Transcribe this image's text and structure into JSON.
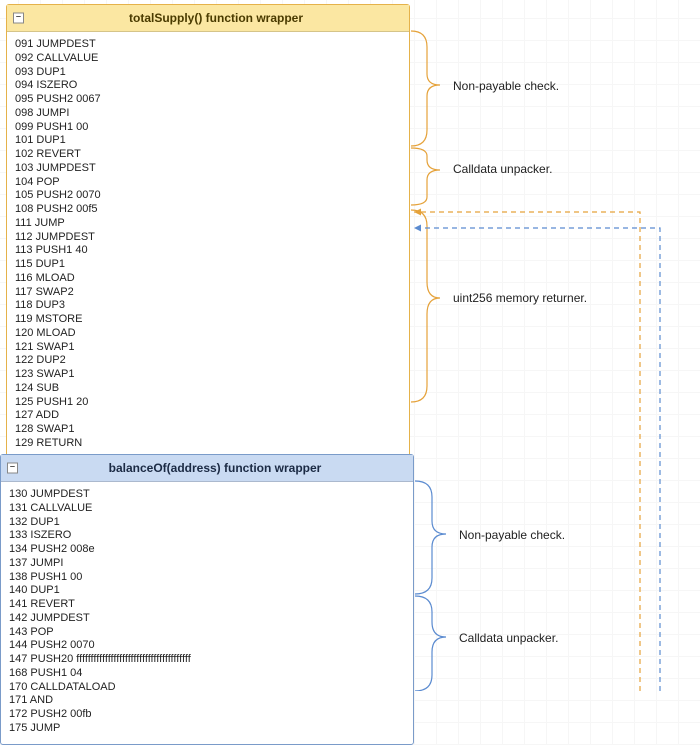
{
  "panels": {
    "totalSupply": {
      "title": "totalSupply() function wrapper",
      "collapse_glyph": "−",
      "instructions": [
        "091 JUMPDEST",
        "092 CALLVALUE",
        "093 DUP1",
        "094 ISZERO",
        "095 PUSH2 0067",
        "098 JUMPI",
        "099 PUSH1 00",
        "101 DUP1",
        "102 REVERT",
        "103 JUMPDEST",
        "104 POP",
        "105 PUSH2 0070",
        "108 PUSH2 00f5",
        "111 JUMP",
        "112 JUMPDEST",
        "113 PUSH1 40",
        "115 DUP1",
        "116 MLOAD",
        "117 SWAP2",
        "118 DUP3",
        "119 MSTORE",
        "120 MLOAD",
        "121 SWAP1",
        "122 DUP2",
        "123 SWAP1",
        "124 SUB",
        "125 PUSH1 20",
        "127 ADD",
        "128 SWAP1",
        "129 RETURN"
      ]
    },
    "balanceOf": {
      "title": "balanceOf(address) function wrapper",
      "collapse_glyph": "−",
      "instructions": [
        "130 JUMPDEST",
        "131 CALLVALUE",
        "132 DUP1",
        "133 ISZERO",
        "134 PUSH2 008e",
        "137 JUMPI",
        "138 PUSH1 00",
        "140 DUP1",
        "141 REVERT",
        "142 JUMPDEST",
        "143 POP",
        "144 PUSH2 0070",
        "147 PUSH20 ffffffffffffffffffffffffffffffffffffffff",
        "168 PUSH1 04",
        "170 CALLDATALOAD",
        "171 AND",
        "172 PUSH2 00fb",
        "175 JUMP"
      ]
    }
  },
  "labels": {
    "l1": "Non-payable check.",
    "l2": "Calldata unpacker.",
    "l3": "uint256 memory returner.",
    "l4": "Non-payable check.",
    "l5": "Calldata unpacker."
  },
  "colors": {
    "orange": "#e5a23a",
    "blue": "#5b8bd0"
  }
}
